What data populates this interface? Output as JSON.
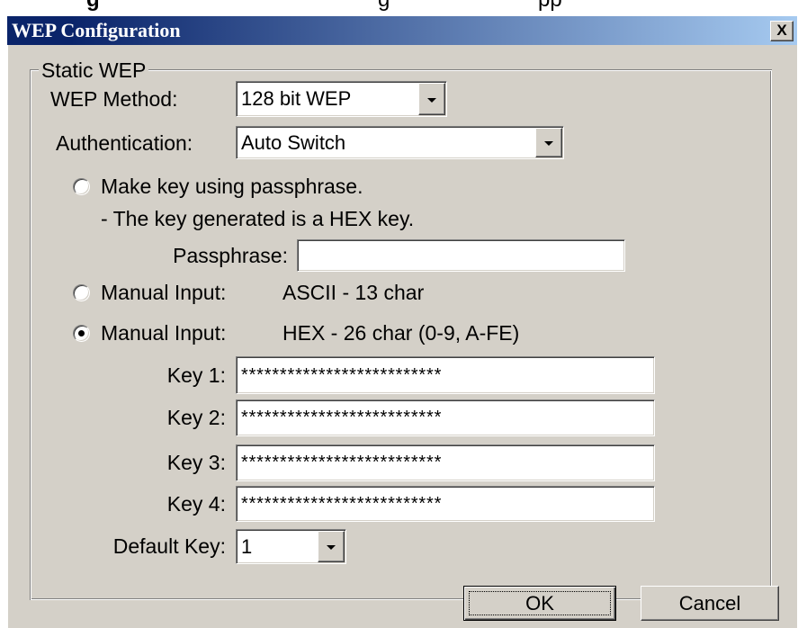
{
  "theme": {
    "title_gradient_start": "#0a246a",
    "title_gradient_end": "#a6caf0",
    "face": "#d4d0c8"
  },
  "caption_fragments": [
    "g",
    "g",
    "pp"
  ],
  "window": {
    "title": "WEP Configuration",
    "close_label": "X"
  },
  "static_wep": {
    "legend": "Static WEP",
    "wep_method": {
      "label": "WEP Method:",
      "value": "128 bit WEP"
    },
    "authentication": {
      "label": "Authentication:",
      "value": "Auto Switch"
    },
    "passphrase_option": {
      "label": "Make key using passphrase.",
      "note": "- The key generated is a HEX key.",
      "selected": false
    },
    "passphrase": {
      "label": "Passphrase:",
      "value": ""
    },
    "manual_ascii": {
      "label": "Manual Input:",
      "hint": "ASCII - 13 char",
      "selected": false
    },
    "manual_hex": {
      "label": "Manual Input:",
      "hint": "HEX - 26 char (0-9, A-FE)",
      "selected": true
    },
    "keys": [
      {
        "label": "Key 1:",
        "value": "**************************"
      },
      {
        "label": "Key 2:",
        "value": "**************************"
      },
      {
        "label": "Key 3:",
        "value": "**************************"
      },
      {
        "label": "Key 4:",
        "value": "**************************"
      }
    ],
    "default_key": {
      "label": "Default Key:",
      "value": "1"
    }
  },
  "buttons": {
    "ok": "OK",
    "cancel": "Cancel"
  },
  "icons": {
    "close": "close-icon",
    "dropdown": "chevron-down-icon"
  }
}
